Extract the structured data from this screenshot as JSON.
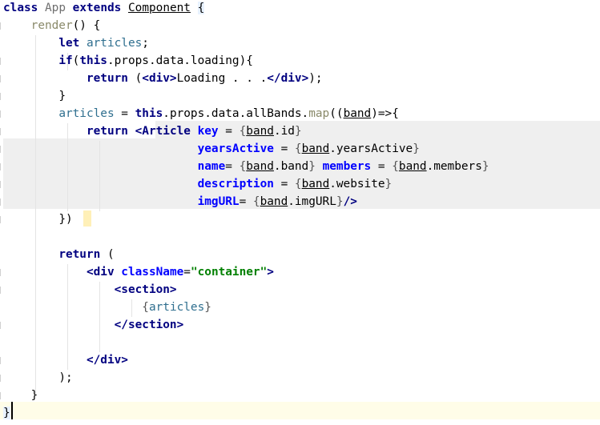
{
  "code": {
    "lines": [
      [
        {
          "t": "class",
          "c": "kw"
        },
        {
          "t": " "
        },
        {
          "t": "App",
          "c": "dim"
        },
        {
          "t": " "
        },
        {
          "t": "extends",
          "c": "kw"
        },
        {
          "t": " "
        },
        {
          "t": "Component",
          "c": "ul"
        },
        {
          "t": " "
        },
        {
          "t": "{",
          "c": "brace-hl punct"
        }
      ],
      [
        {
          "t": "    "
        },
        {
          "t": "render",
          "c": "fn"
        },
        {
          "t": "() {"
        }
      ],
      [
        {
          "t": "        "
        },
        {
          "t": "let",
          "c": "kw"
        },
        {
          "t": " "
        },
        {
          "t": "articles",
          "c": "var"
        },
        {
          "t": ";"
        }
      ],
      [
        {
          "t": "        "
        },
        {
          "t": "if",
          "c": "kw"
        },
        {
          "t": "("
        },
        {
          "t": "this",
          "c": "kw"
        },
        {
          "t": ".props.data.loading){"
        }
      ],
      [
        {
          "t": "            "
        },
        {
          "t": "return",
          "c": "kw"
        },
        {
          "t": " ("
        },
        {
          "t": "<div>",
          "c": "tag"
        },
        {
          "t": "Loading . . ."
        },
        {
          "t": "</div>",
          "c": "tag"
        },
        {
          "t": ");"
        }
      ],
      [
        {
          "t": "        "
        },
        {
          "t": "}"
        }
      ],
      [
        {
          "t": "        "
        },
        {
          "t": "articles",
          "c": "var"
        },
        {
          "t": " = "
        },
        {
          "t": "this",
          "c": "kw"
        },
        {
          "t": ".props.data.allBands."
        },
        {
          "t": "map",
          "c": "fn"
        },
        {
          "t": "(("
        },
        {
          "t": "band",
          "c": "ul"
        },
        {
          "t": ")=>{"
        }
      ],
      [
        {
          "t": "            "
        },
        {
          "t": "return",
          "c": "kw"
        },
        {
          "t": " "
        },
        {
          "t": "<Article",
          "c": "tag"
        },
        {
          "t": " "
        },
        {
          "t": "key",
          "c": "attr"
        },
        {
          "t": " = "
        },
        {
          "t": "{",
          "c": "curly"
        },
        {
          "t": "band",
          "c": "ul"
        },
        {
          "t": ".id"
        },
        {
          "t": "}",
          "c": "curly"
        }
      ],
      [
        {
          "t": "                            "
        },
        {
          "t": "yearsActive",
          "c": "attr"
        },
        {
          "t": " = "
        },
        {
          "t": "{",
          "c": "curly"
        },
        {
          "t": "band",
          "c": "ul"
        },
        {
          "t": ".yearsActive"
        },
        {
          "t": "}",
          "c": "curly"
        }
      ],
      [
        {
          "t": "                            "
        },
        {
          "t": "name",
          "c": "attr"
        },
        {
          "t": "= "
        },
        {
          "t": "{",
          "c": "curly"
        },
        {
          "t": "band",
          "c": "ul"
        },
        {
          "t": ".band"
        },
        {
          "t": "}",
          "c": "curly"
        },
        {
          "t": " "
        },
        {
          "t": "members",
          "c": "attr"
        },
        {
          "t": " = "
        },
        {
          "t": "{",
          "c": "curly"
        },
        {
          "t": "band",
          "c": "ul"
        },
        {
          "t": ".members"
        },
        {
          "t": "}",
          "c": "curly"
        }
      ],
      [
        {
          "t": "                            "
        },
        {
          "t": "description",
          "c": "attr"
        },
        {
          "t": " = "
        },
        {
          "t": "{",
          "c": "curly"
        },
        {
          "t": "band",
          "c": "ul"
        },
        {
          "t": ".website"
        },
        {
          "t": "}",
          "c": "curly"
        }
      ],
      [
        {
          "t": "                            "
        },
        {
          "t": "imgURL",
          "c": "attr"
        },
        {
          "t": "= "
        },
        {
          "t": "{",
          "c": "curly"
        },
        {
          "t": "band",
          "c": "ul"
        },
        {
          "t": ".imgURL"
        },
        {
          "t": "}",
          "c": "curly"
        },
        {
          "t": "/>",
          "c": "tag"
        }
      ],
      [
        {
          "t": "        "
        },
        {
          "t": "})"
        }
      ],
      [
        {
          "t": ""
        }
      ],
      [
        {
          "t": "        "
        },
        {
          "t": "return",
          "c": "kw"
        },
        {
          "t": " ("
        }
      ],
      [
        {
          "t": "            "
        },
        {
          "t": "<div",
          "c": "tag"
        },
        {
          "t": " "
        },
        {
          "t": "className",
          "c": "attr"
        },
        {
          "t": "="
        },
        {
          "t": "\"container\"",
          "c": "str"
        },
        {
          "t": ">",
          "c": "tag"
        }
      ],
      [
        {
          "t": "                "
        },
        {
          "t": "<section>",
          "c": "tag"
        }
      ],
      [
        {
          "t": "                    "
        },
        {
          "t": "{",
          "c": "curly"
        },
        {
          "t": "articles",
          "c": "var"
        },
        {
          "t": "}",
          "c": "curly"
        }
      ],
      [
        {
          "t": "                "
        },
        {
          "t": "</section>",
          "c": "tag"
        }
      ],
      [
        {
          "t": ""
        }
      ],
      [
        {
          "t": "            "
        },
        {
          "t": "</div>",
          "c": "tag"
        }
      ],
      [
        {
          "t": "        "
        },
        {
          "t": ");"
        }
      ],
      [
        {
          "t": "    "
        },
        {
          "t": "}"
        }
      ],
      [
        {
          "t": "}",
          "c": "brace-hl punct"
        }
      ]
    ]
  }
}
